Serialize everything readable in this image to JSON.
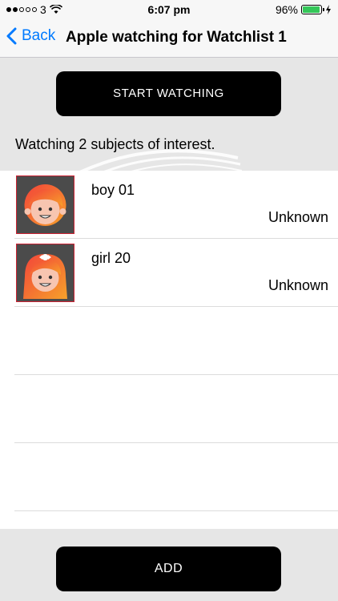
{
  "status_bar": {
    "carrier": "3",
    "time": "6:07 pm",
    "battery": "96%",
    "battery_level": 0.96,
    "icons": [
      "signal-dots-icon",
      "wifi-icon",
      "battery-icon",
      "charging-icon"
    ]
  },
  "nav": {
    "back_label": "Back",
    "title": "Apple watching for Watchlist 1"
  },
  "actions": {
    "start_label": "START WATCHING",
    "add_label": "ADD"
  },
  "summary": "Watching 2 subjects of interest.",
  "subjects": [
    {
      "name": "boy 01",
      "status": "Unknown",
      "icon": "boy-avatar-icon"
    },
    {
      "name": "girl 20",
      "status": "Unknown",
      "icon": "girl-avatar-icon"
    }
  ],
  "colors": {
    "accent": "#007aff",
    "button_bg": "#000000",
    "panel_bg": "#e6e6e6",
    "avatar_face": "#f7c5b0",
    "avatar_hair_gradient": [
      "#f2433a",
      "#f7a12a"
    ]
  }
}
